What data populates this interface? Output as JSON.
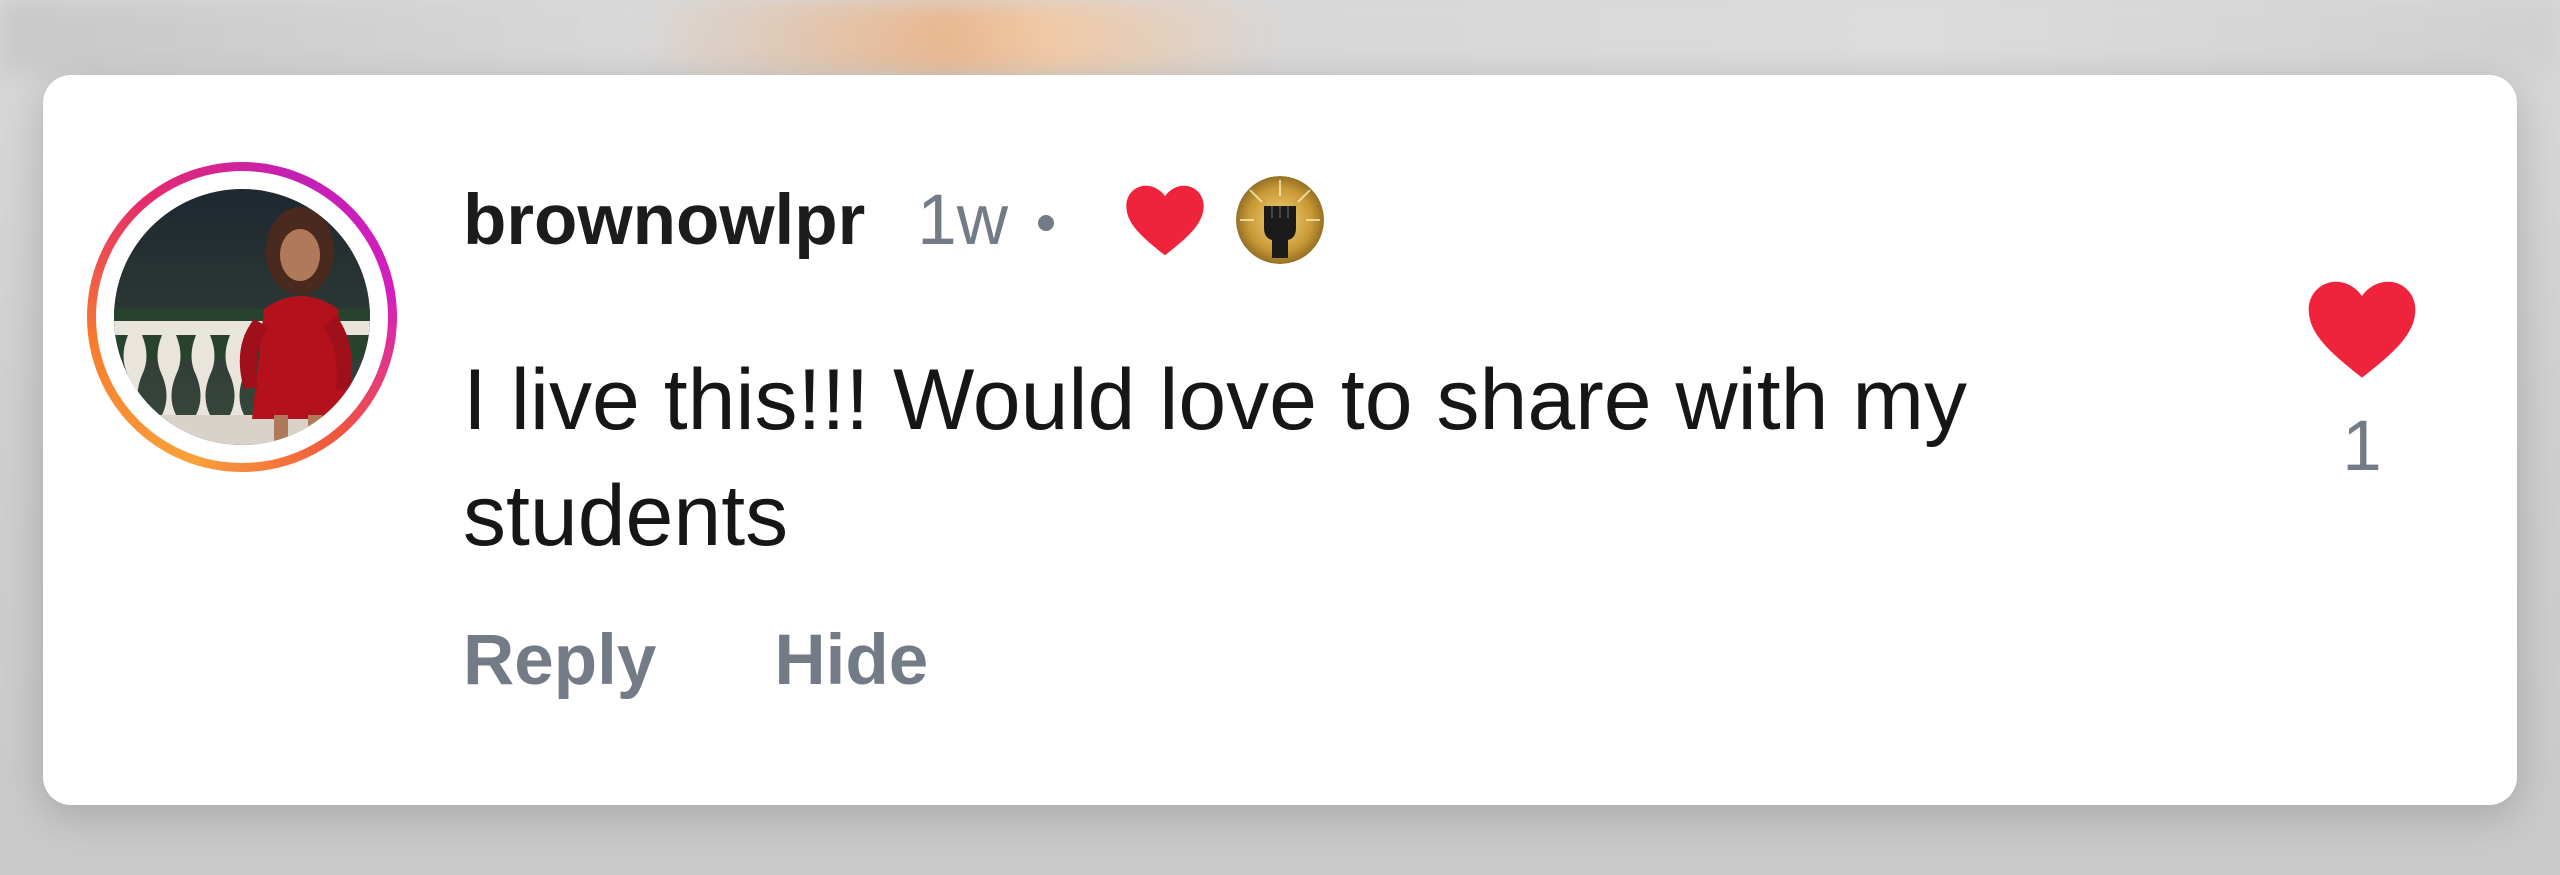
{
  "comment": {
    "username": "brownowlpr",
    "time": "1w",
    "text": "I live this!!! Would love to share with my students",
    "badges": [
      "heart-icon",
      "fist-icon"
    ],
    "like_count": "1",
    "liked": true,
    "actions": {
      "reply_label": "Reply",
      "hide_label": "Hide"
    }
  },
  "colors": {
    "heart": "#f0233c",
    "muted_text": "#737b86",
    "text": "#161616",
    "story_ring_start": "#f9a23a",
    "story_ring_end": "#c220b5"
  }
}
